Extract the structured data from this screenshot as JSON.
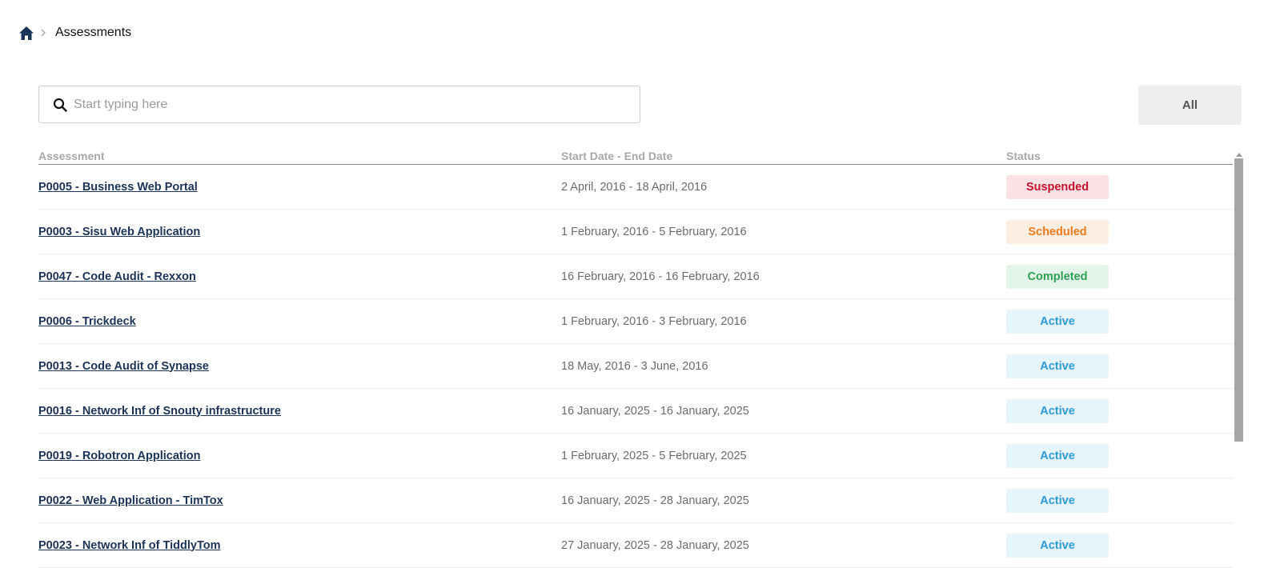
{
  "breadcrumb": {
    "current": "Assessments"
  },
  "search": {
    "placeholder": "Start typing here",
    "value": ""
  },
  "filter": {
    "label": "All"
  },
  "table": {
    "headers": {
      "assessment": "Assessment",
      "dates": "Start Date - End Date",
      "status": "Status"
    },
    "rows": [
      {
        "assessment": "P0005 - Business Web Portal",
        "dates": "2 April, 2016 - 18 April, 2016",
        "status": "Suspended",
        "status_kind": "suspended"
      },
      {
        "assessment": "P0003 - Sisu Web Application",
        "dates": "1 February, 2016 - 5 February, 2016",
        "status": "Scheduled",
        "status_kind": "scheduled"
      },
      {
        "assessment": "P0047 - Code Audit - Rexxon",
        "dates": "16 February, 2016 - 16 February, 2016",
        "status": "Completed",
        "status_kind": "completed"
      },
      {
        "assessment": "P0006 - Trickdeck",
        "dates": "1 February, 2016 - 3 February, 2016",
        "status": "Active",
        "status_kind": "active"
      },
      {
        "assessment": "P0013 - Code Audit of Synapse",
        "dates": "18 May, 2016 - 3 June, 2016",
        "status": "Active",
        "status_kind": "active"
      },
      {
        "assessment": "P0016 - Network Inf of Snouty infrastructure",
        "dates": "16 January, 2025 - 16 January, 2025",
        "status": "Active",
        "status_kind": "active"
      },
      {
        "assessment": "P0019 - Robotron Application",
        "dates": "1 February, 2025 - 5 February, 2025",
        "status": "Active",
        "status_kind": "active"
      },
      {
        "assessment": "P0022 - Web Application - TimTox",
        "dates": "16 January, 2025 - 28 January, 2025",
        "status": "Active",
        "status_kind": "active"
      },
      {
        "assessment": "P0023 - Network Inf of TiddlyTom",
        "dates": "27 January, 2025 - 28 January, 2025",
        "status": "Active",
        "status_kind": "active"
      }
    ]
  },
  "colors": {
    "link": "#1c3358",
    "suspended": "#c8102e",
    "scheduled": "#ee7a1e",
    "completed": "#2e9f55",
    "active": "#2d9bd6"
  },
  "icons": {
    "home": "home-icon",
    "breadcrumb_separator": "chevron-right-icon",
    "search": "search-icon",
    "scroll_up": "triangle-up-icon"
  }
}
